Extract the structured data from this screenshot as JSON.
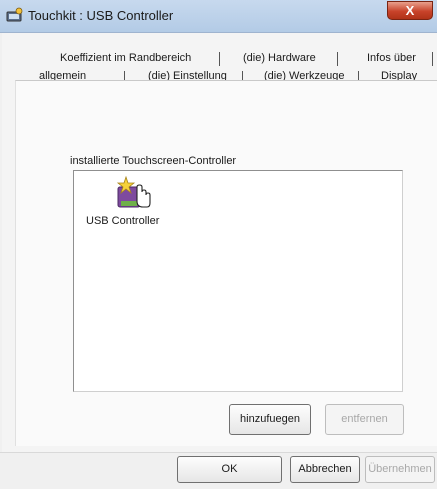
{
  "window": {
    "title": "Touchkit : USB Controller",
    "close_glyph": "X",
    "app_icon": "touchkit-app-icon"
  },
  "tabs": {
    "row1": [
      "Koeffizient im Randbereich",
      "(die) Hardware",
      "Infos über"
    ],
    "row2": [
      "allgemein",
      "(die) Einstellung",
      "(die) Werkzeuge",
      "Display"
    ],
    "active": "allgemein"
  },
  "panel": {
    "group_label": "installierte Touchscreen-Controller",
    "devices": [
      {
        "label": "USB Controller",
        "icon": "usb-controller-icon"
      }
    ],
    "add_button": "hinzufuegen",
    "remove_button": "entfernen"
  },
  "footer": {
    "ok": "OK",
    "cancel": "Abbrechen",
    "apply": "Übernehmen"
  }
}
